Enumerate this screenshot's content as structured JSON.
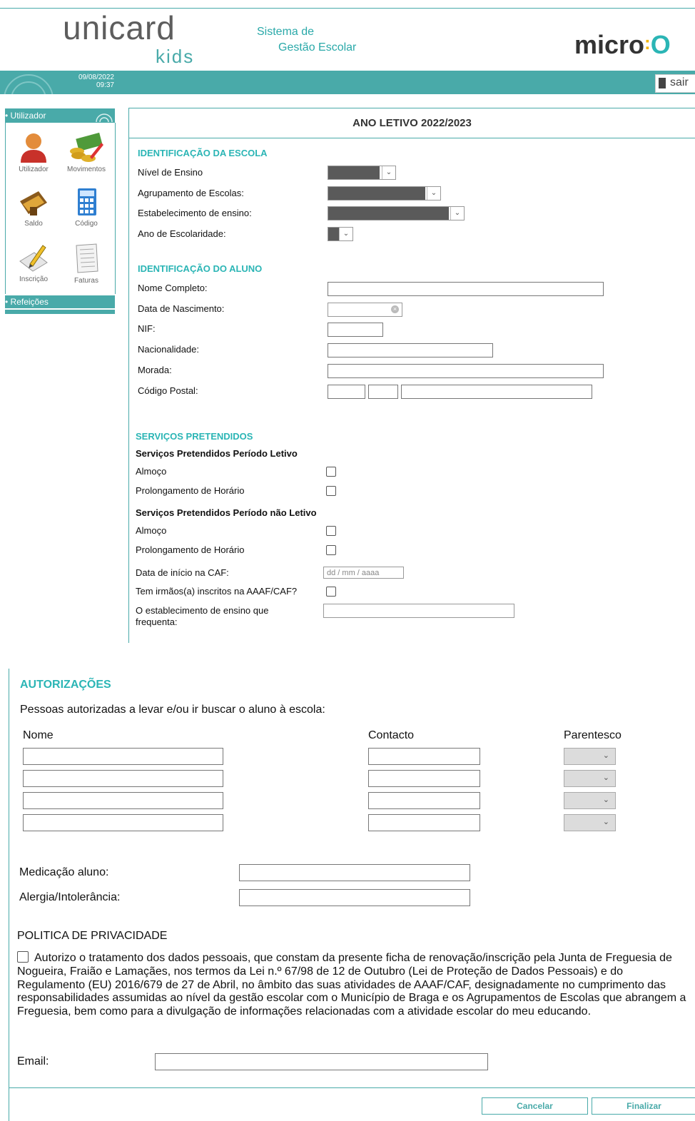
{
  "header": {
    "logo_main": "unicard",
    "logo_sub": "kids",
    "system_line1": "Sistema de",
    "system_line2": "Gestão Escolar",
    "brand_right_prefix": "micro",
    "brand_right_suffix": "O",
    "date": "09/08/2022",
    "time": "09:37",
    "logout_label": "sair"
  },
  "sidebar": {
    "section_user": "• Utilizador",
    "items": [
      {
        "label": "Utilizador"
      },
      {
        "label": "Movimentos"
      },
      {
        "label": "Saldo"
      },
      {
        "label": "Código"
      },
      {
        "label": "Inscrição"
      },
      {
        "label": "Faturas"
      }
    ],
    "section_meals": "• Refeições"
  },
  "form": {
    "title": "ANO LETIVO 2022/2023",
    "school": {
      "heading": "IDENTIFICAÇÃO DA ESCOLA",
      "fields": [
        {
          "label": "Nível de Ensino"
        },
        {
          "label": "Agrupamento de Escolas:"
        },
        {
          "label": "Estabelecimento de ensino:"
        },
        {
          "label": "Ano de Escolaridade:"
        }
      ]
    },
    "student": {
      "heading": "IDENTIFICAÇÃO DO ALUNO",
      "fields": [
        {
          "label": "Nome Completo:"
        },
        {
          "label": "Data de Nascimento:"
        },
        {
          "label": "NIF:"
        },
        {
          "label": "Nacionalidade:"
        },
        {
          "label": "Morada:"
        },
        {
          "label": "Código Postal:"
        }
      ]
    },
    "services": {
      "heading": "SERVIÇOS PRETENDIDOS",
      "school_period_heading": "Serviços Pretendidos Período Letivo",
      "school_period": [
        {
          "label": "Almoço"
        },
        {
          "label": "Prolongamento de Horário"
        }
      ],
      "non_school_period_heading": "Serviços Pretendidos Período não Letivo",
      "non_school_period": [
        {
          "label": "Almoço"
        },
        {
          "label": "Prolongamento de Horário"
        }
      ],
      "caf_start_label": "Data de início na CAF:",
      "caf_start_placeholder": "dd / mm / aaaa",
      "siblings_label": "Tem irmãos(a) inscritos na AAAF/CAF?",
      "school_attended_label": "O establecimento de ensino que frequenta:"
    }
  },
  "authorizations": {
    "heading": "AUTORIZAÇÕES",
    "intro": "Pessoas autorizadas a levar e/ou ir buscar o aluno à escola:",
    "col_name": "Nome",
    "col_contact": "Contacto",
    "col_relation": "Parentesco",
    "medication_label": "Medicação aluno:",
    "allergy_label": "Alergia/Intolerância:"
  },
  "privacy": {
    "heading": "POLITICA DE PRIVACIDADE",
    "consent_text": "Autorizo o tratamento dos dados pessoais, que constam da presente ficha de renovação/inscrição pela Junta de Freguesia de Nogueira, Fraião e Lamaçães, nos termos da Lei n.º 67/98 de 12 de Outubro (Lei de Proteção de Dados Pessoais) e do Regulamento (EU) 2016/679 de 27 de Abril, no âmbito das suas atividades de AAAF/CAF, designadamente no cumprimento das responsabilidades assumidas ao nível da gestão escolar com o Município de Braga e os Agrupamentos de Escolas que abrangem a Freguesia, bem como para a divulgação de informações relacionadas com a atividade escolar do meu educando.",
    "email_label": "Email:"
  },
  "actions": {
    "cancel_label": "Cancelar",
    "finish_label": "Finalizar"
  },
  "colors": {
    "accent": "#49aaa9",
    "heading_teal": "#2bb5b5",
    "logo_grey": "#5d5d5d"
  }
}
